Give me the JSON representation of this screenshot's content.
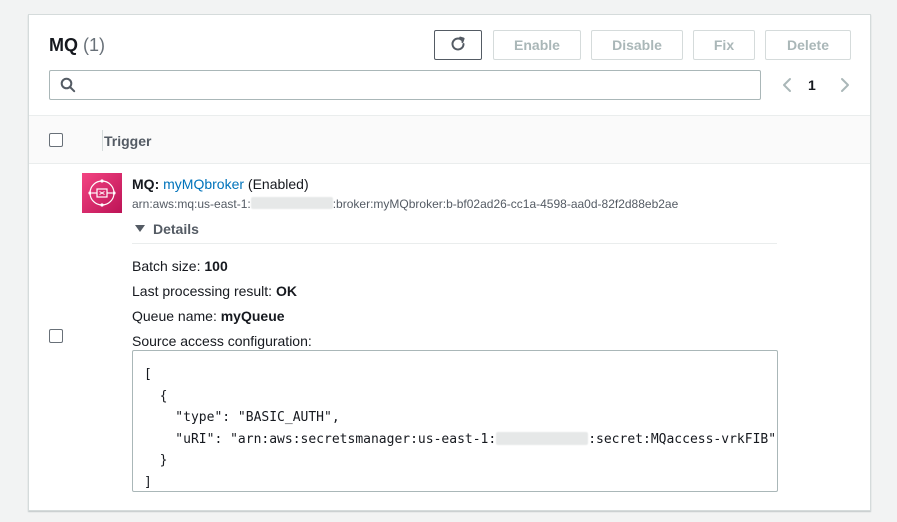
{
  "header": {
    "title": "MQ",
    "count": "(1)"
  },
  "toolbar": {
    "refresh_icon": "refresh-icon",
    "enable_label": "Enable",
    "disable_label": "Disable",
    "fix_label": "Fix",
    "delete_label": "Delete"
  },
  "search": {
    "value": "",
    "placeholder": "",
    "icon": "search-icon"
  },
  "pagination": {
    "current_page": "1"
  },
  "table": {
    "columns": [
      "Trigger"
    ]
  },
  "trigger": {
    "service_label": "MQ",
    "service_sep": ":",
    "name": "myMQbroker",
    "state": "(Enabled)",
    "arn_prefix": "arn:aws:mq:us-east-1:",
    "arn_suffix": ":broker:myMQbroker:b-bf02ad26-cc1a-4598-aa0d-82f2d88eb2ae",
    "details_label": "Details",
    "batch_size_label": "Batch size:",
    "batch_size_value": "100",
    "last_result_label": "Last processing result:",
    "last_result_value": "OK",
    "queue_label": "Queue name:",
    "queue_value": "myQueue",
    "source_access_label": "Source access configuration:",
    "code": {
      "open_bracket": "[",
      "open_brace": "  {",
      "type_line": "    \"type\": \"BASIC_AUTH\",",
      "uri_prefix": "    \"uRI\": \"arn:aws:secretsmanager:us-east-1:",
      "uri_suffix": ":secret:MQaccess-vrkFIB\"",
      "close_brace": "  }",
      "close_bracket": "]"
    }
  },
  "colors": {
    "link": "#0073bb",
    "icon_gradient_start": "#f34482",
    "icon_gradient_end": "#bc1356",
    "disabled_text": "#aab7b8"
  }
}
